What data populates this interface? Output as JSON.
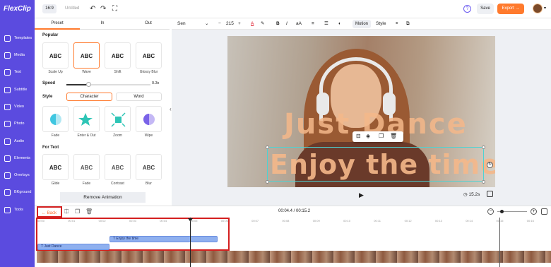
{
  "app": {
    "logo": "FlexClip",
    "ratio": "16:9",
    "title": "Untitled"
  },
  "header": {
    "save_label": "Save",
    "export_label": "Export →"
  },
  "sidebar": {
    "items": [
      {
        "label": "Templates",
        "icon": "templates-icon"
      },
      {
        "label": "Media",
        "icon": "media-icon"
      },
      {
        "label": "Text",
        "icon": "text-icon"
      },
      {
        "label": "Subtitle",
        "icon": "subtitle-icon"
      },
      {
        "label": "Video",
        "icon": "video-icon"
      },
      {
        "label": "Photo",
        "icon": "photo-icon"
      },
      {
        "label": "Audio",
        "icon": "audio-icon"
      },
      {
        "label": "Elements",
        "icon": "elements-icon"
      },
      {
        "label": "Overlays",
        "icon": "overlays-icon"
      },
      {
        "label": "BKground",
        "icon": "background-icon"
      },
      {
        "label": "Tools",
        "icon": "tools-icon"
      }
    ]
  },
  "panel": {
    "tabs": [
      "Preset",
      "In",
      "Out"
    ],
    "popular_label": "Popular",
    "popular": [
      {
        "caption": "Scale Up",
        "sample": "ABC"
      },
      {
        "caption": "Wave",
        "sample": "ABC"
      },
      {
        "caption": "Shift",
        "sample": "ABC"
      },
      {
        "caption": "Glossy Blur",
        "sample": "ABC"
      }
    ],
    "speed_label": "Speed",
    "speed_value": "0.3x",
    "style_label": "Style",
    "style_options": [
      "Character",
      "Word"
    ],
    "effects": [
      {
        "caption": "Fade"
      },
      {
        "caption": "Enter & Out"
      },
      {
        "caption": "Zoom"
      },
      {
        "caption": "Wipe"
      }
    ],
    "for_text_label": "For Text",
    "for_text": [
      {
        "caption": "Glide",
        "sample": "ABC"
      },
      {
        "caption": "Fade",
        "sample": "ABC"
      },
      {
        "caption": "Contrast",
        "sample": "ABC"
      },
      {
        "caption": "Blur",
        "sample": "ABC"
      }
    ],
    "remove_label": "Remove Animation"
  },
  "format": {
    "font": "Sen",
    "size": "215",
    "motion_label": "Motion",
    "style_label": "Style"
  },
  "canvas": {
    "line1": "Just Dance",
    "line2": "Enjoy the time",
    "duration": "15.2s"
  },
  "timeline": {
    "back_label": "Back",
    "time": "00:04.4 / 00:15.2",
    "ticks": [
      "00:00",
      "00:01",
      "00:02",
      "00:03",
      "00:04",
      "00:05",
      "00:06",
      "00:07",
      "00:08",
      "00:09",
      "00:10",
      "00:11",
      "00:12",
      "00:13",
      "00:14",
      "00:15",
      "00:16"
    ],
    "clip1": "Enjoy the time",
    "clip2": "Just Dance"
  }
}
